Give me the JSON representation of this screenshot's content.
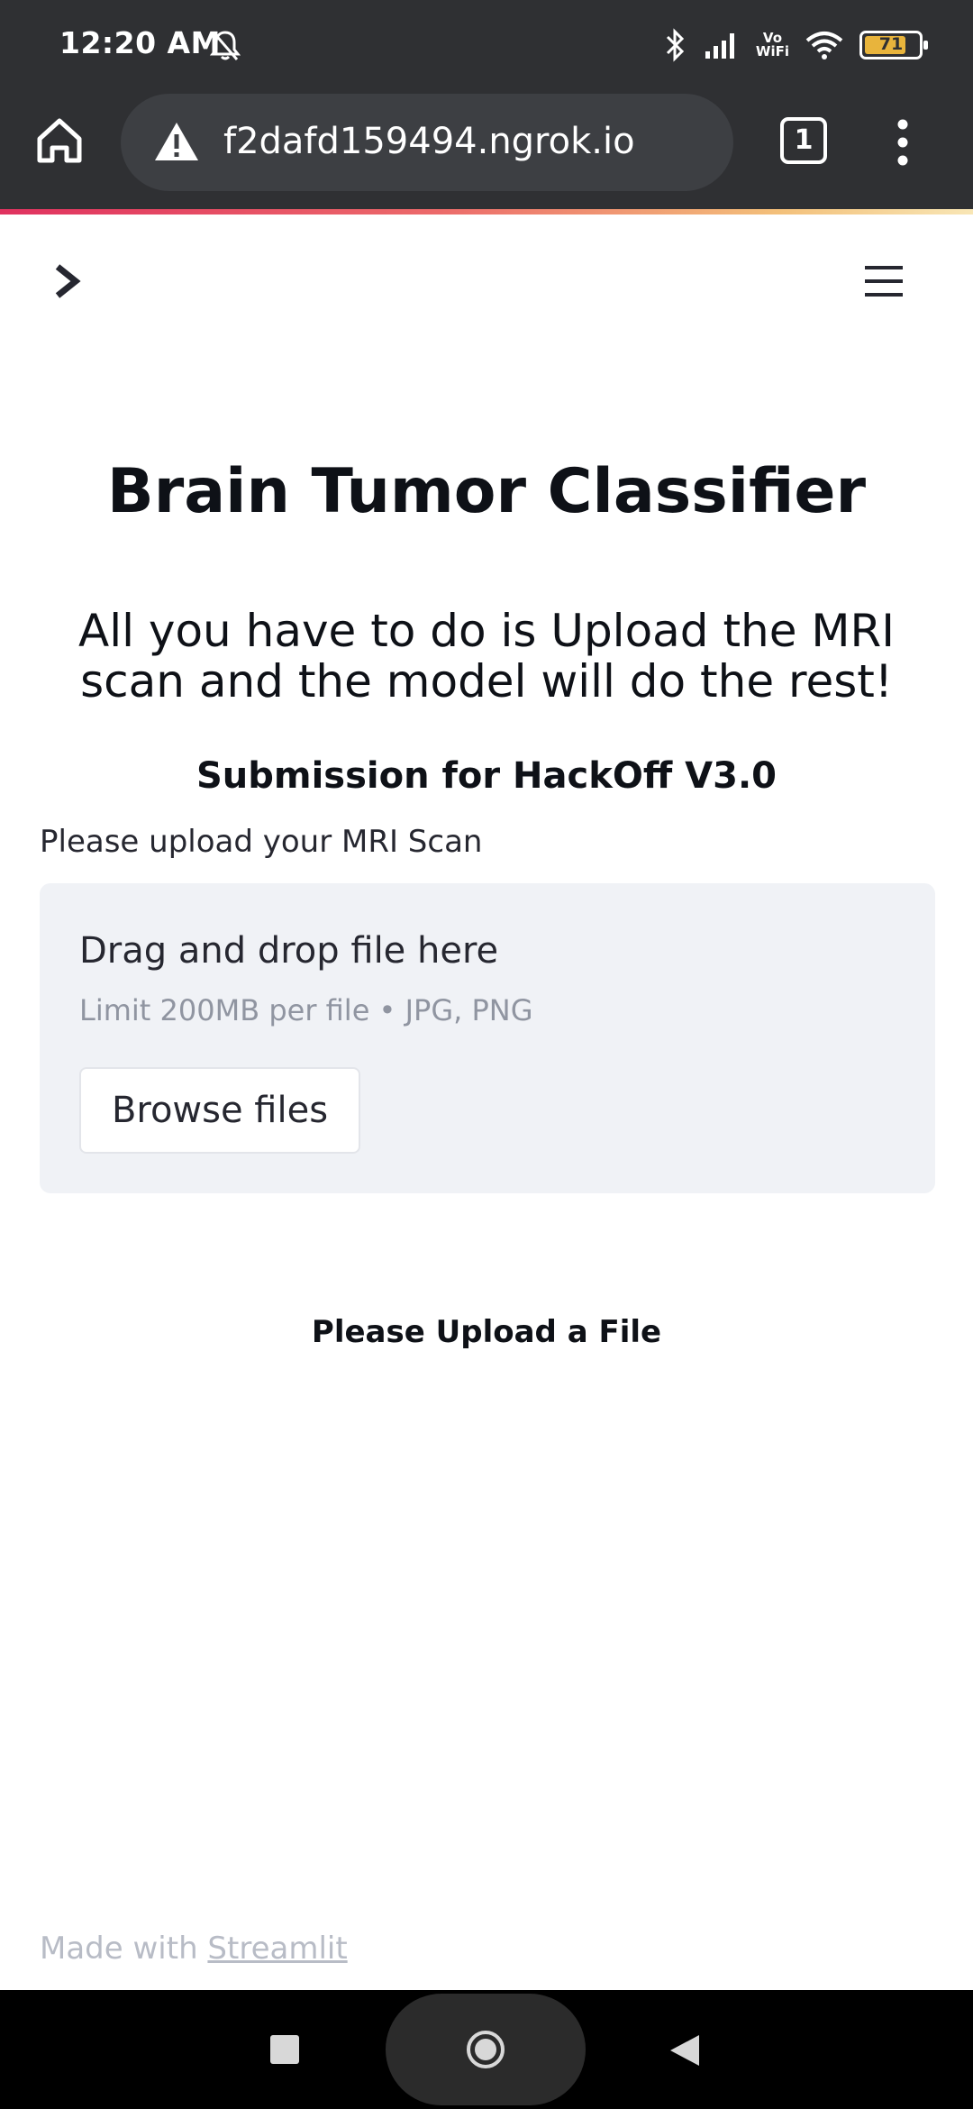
{
  "status_bar": {
    "time": "12:20 AM",
    "battery_level": "71",
    "icons": [
      "bell-off-icon",
      "bluetooth-icon",
      "signal-icon",
      "vowifi-icon",
      "wifi-icon",
      "battery-icon"
    ],
    "vowifi_label_top": "Vo",
    "vowifi_label_bottom": "WiFi"
  },
  "browser": {
    "url": "f2dafd159494.ngrok.io",
    "tab_count": "1",
    "icons": [
      "home-icon",
      "warning-icon",
      "tabs-icon",
      "more-vert-icon"
    ]
  },
  "app": {
    "title": "Brain Tumor Classifier",
    "subtitle": "All you have to do is Upload the MRI scan and the model will do the rest!",
    "submission": "Submission for HackOff V3.0",
    "upload_label": "Please upload your MRI Scan",
    "dropzone": {
      "title": "Drag and drop file here",
      "limit": "Limit 200MB per file • JPG, PNG",
      "button": "Browse files"
    },
    "status_message": "Please Upload a File",
    "footer": {
      "prefix": "Made with ",
      "link": "Streamlit"
    }
  },
  "colors": {
    "toolbar_bg": "#2f3033",
    "accent_gradient_start": "#e0325f",
    "dropzone_bg": "#f0f2f6",
    "text": "#262730"
  }
}
